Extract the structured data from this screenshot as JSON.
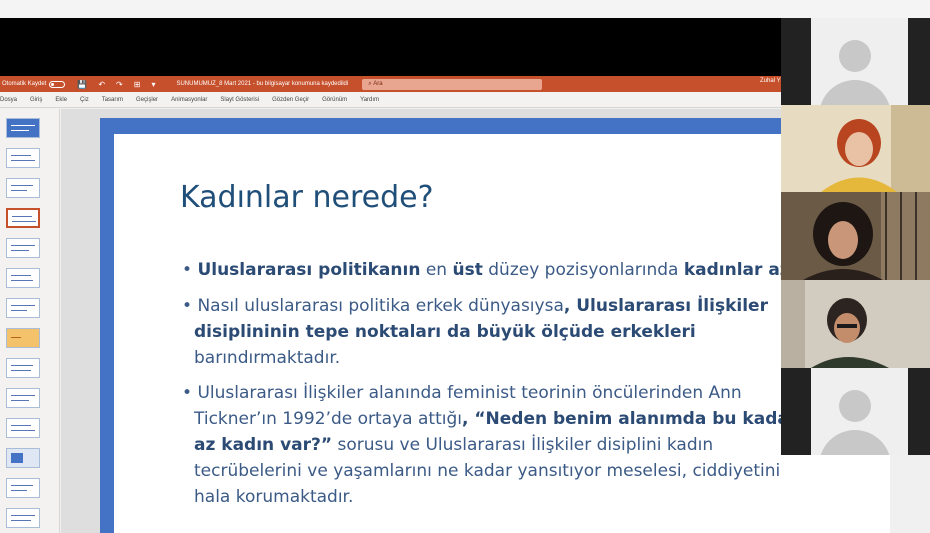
{
  "titlebar": {
    "autosave_label": "Otomatik Kaydet",
    "doc_title": "SUNUMUMUZ_8 Mart 2021 - bu bilgisayar konumuna kaydedildi",
    "search_placeholder": "Ara",
    "user_name": "Zuhal Y"
  },
  "menu": [
    "Dosya",
    "Giriş",
    "Ekle",
    "Çiz",
    "Tasarım",
    "Geçişler",
    "Animasyonlar",
    "Slayt Gösterisi",
    "Gözden Geçir",
    "Görünüm",
    "Yardım"
  ],
  "slide": {
    "title": "Kadınlar nerede?",
    "b1": {
      "bullet": "•",
      "s1": "Uluslararası politikanın",
      "t2": " en ",
      "s3": "üst",
      "t4": " düzey pozisyonlarında ",
      "s5": "kadınlar az",
      "t6": "."
    },
    "b2": {
      "bullet": "•",
      "t1": "Nasıl uluslararası politika erkek dünyasıysa",
      "s2": ", Uluslararası İlişkiler",
      "s3": "disiplininin tepe noktaları da büyük ölçüde erkekleri",
      "t4": "barındırmaktadır."
    },
    "b3": {
      "bullet": "•",
      "t1": "Uluslararası İlişkiler alanında feminist teorinin öncülerinden Ann",
      "t2": "Tickner’ın 1992’de ortaya attığı",
      "s3": ", “Neden benim alanımda bu kadar",
      "s4": "az kadın var?”",
      "t5": " sorusu ve Uluslararası İlişkiler disiplini kadın",
      "t6": "tecrübelerini ve yaşamlarını ne kadar yansıtıyor meselesi, ciddiyetini",
      "t7": "hala korumaktadır."
    }
  },
  "colors": {
    "accent": "#c6502c",
    "slide_border": "#4472c4",
    "title_text": "#1f4e79",
    "body_text": "#3b5a86"
  }
}
